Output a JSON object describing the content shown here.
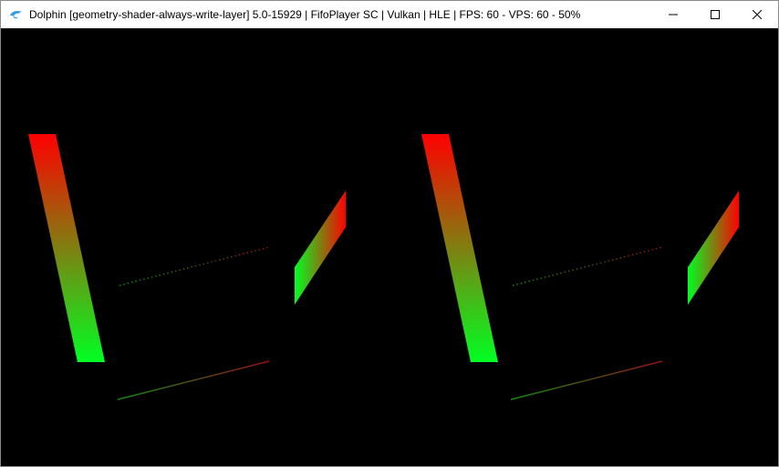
{
  "window": {
    "title": "Dolphin [geometry-shader-always-write-layer] 5.0-15929 | FifoPlayer SC | Vulkan | HLE | FPS: 60 - VPS: 60 - 50%",
    "app_icon": "dolphin-icon",
    "controls": {
      "minimize_icon": "minimize-icon",
      "maximize_icon": "maximize-icon",
      "close_icon": "close-icon"
    }
  },
  "render": {
    "background": "#000000",
    "colors": {
      "red": "#ff0000",
      "green": "#00ff22"
    }
  }
}
